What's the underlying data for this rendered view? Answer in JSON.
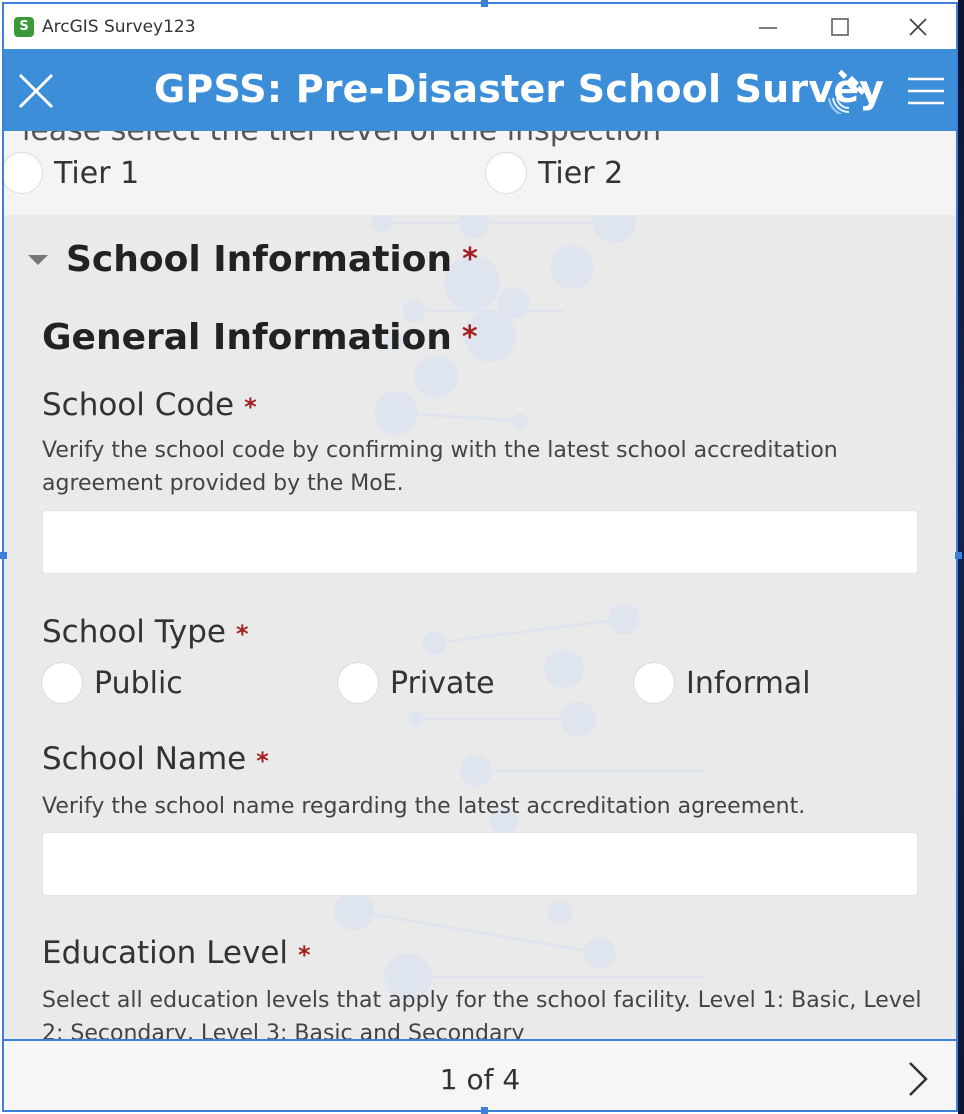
{
  "window": {
    "app_title": "ArcGIS Survey123",
    "app_icon_letter": "S",
    "controls": {
      "minimize": "—",
      "maximize": "☐",
      "close": "✕"
    }
  },
  "header": {
    "title": "GPSS: Pre-Disaster School Survey",
    "close_icon": "close-icon",
    "gps_icon": "satellite-icon",
    "menu_icon": "hamburger-menu-icon",
    "color": "#3d8ed8"
  },
  "tier_question": {
    "cut_label": "lease select the tier level of the inspection",
    "options": [
      "Tier 1",
      "Tier 2"
    ]
  },
  "section": {
    "group_title": "School Information",
    "subgroup_title": "General Information",
    "required_marker": "*"
  },
  "questions": {
    "school_code": {
      "label": "School Code",
      "hint": "Verify the school code by confirming with the latest school accreditation agreement provided by the MoE.",
      "value": ""
    },
    "school_type": {
      "label": "School Type",
      "options": [
        "Public",
        "Private",
        "Informal"
      ]
    },
    "school_name": {
      "label": "School Name",
      "hint": "Verify the school name regarding the latest accreditation agreement.",
      "value": ""
    },
    "education_level": {
      "label": "Education Level",
      "hint": "Select all education levels that apply for the school facility. Level 1: Basic, Level 2: Secondary, Level 3: Basic and Secondary"
    }
  },
  "footer": {
    "page_indicator": "1 of 4",
    "next_icon": "chevron-right-icon"
  },
  "colors": {
    "accent": "#3d8ed8",
    "required": "#a31f1f",
    "selection": "#3d80d8"
  }
}
